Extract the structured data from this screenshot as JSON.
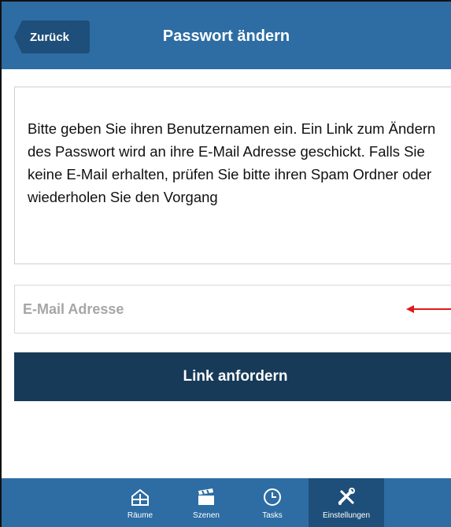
{
  "header": {
    "back_label": "Zurück",
    "title": "Passwort ändern"
  },
  "info": {
    "text": "Bitte geben Sie ihren Benutzernamen ein. Ein Link zum Ändern des Passwort wird an ihre E-Mail Adresse geschickt. Falls Sie keine E-Mail erhalten, prüfen Sie bitte ihren Spam Ordner oder wiederholen Sie den Vorgang"
  },
  "email": {
    "placeholder": "E-Mail Adresse",
    "value": ""
  },
  "submit": {
    "label": "Link anfordern"
  },
  "tabs": [
    {
      "label": "Räume",
      "icon": "house-icon"
    },
    {
      "label": "Szenen",
      "icon": "clapperboard-icon"
    },
    {
      "label": "Tasks",
      "icon": "clock-icon"
    },
    {
      "label": "Einstellungen",
      "icon": "tools-icon",
      "active": true
    }
  ],
  "colors": {
    "header": "#2d6da3",
    "back_button": "#1e4f7a",
    "submit_button": "#163a58",
    "annotation_arrow": "#e01818"
  }
}
